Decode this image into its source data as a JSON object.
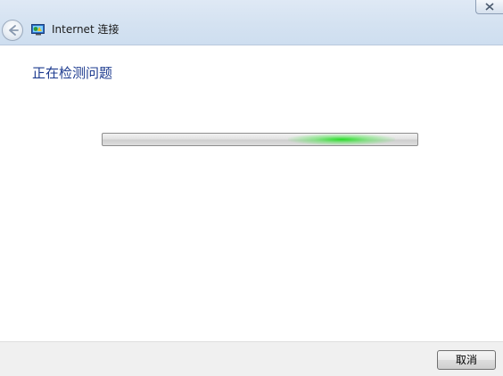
{
  "window": {
    "title": "Internet 连接",
    "close_icon": "close-icon",
    "back_icon": "back-arrow-icon",
    "app_icon": "network-diagnostics-icon"
  },
  "main": {
    "heading": "正在检测问题"
  },
  "progress": {
    "state": "indeterminate",
    "glow_fraction": 0.76,
    "accent_color": "#28d828"
  },
  "footer": {
    "cancel_label": "取消"
  }
}
